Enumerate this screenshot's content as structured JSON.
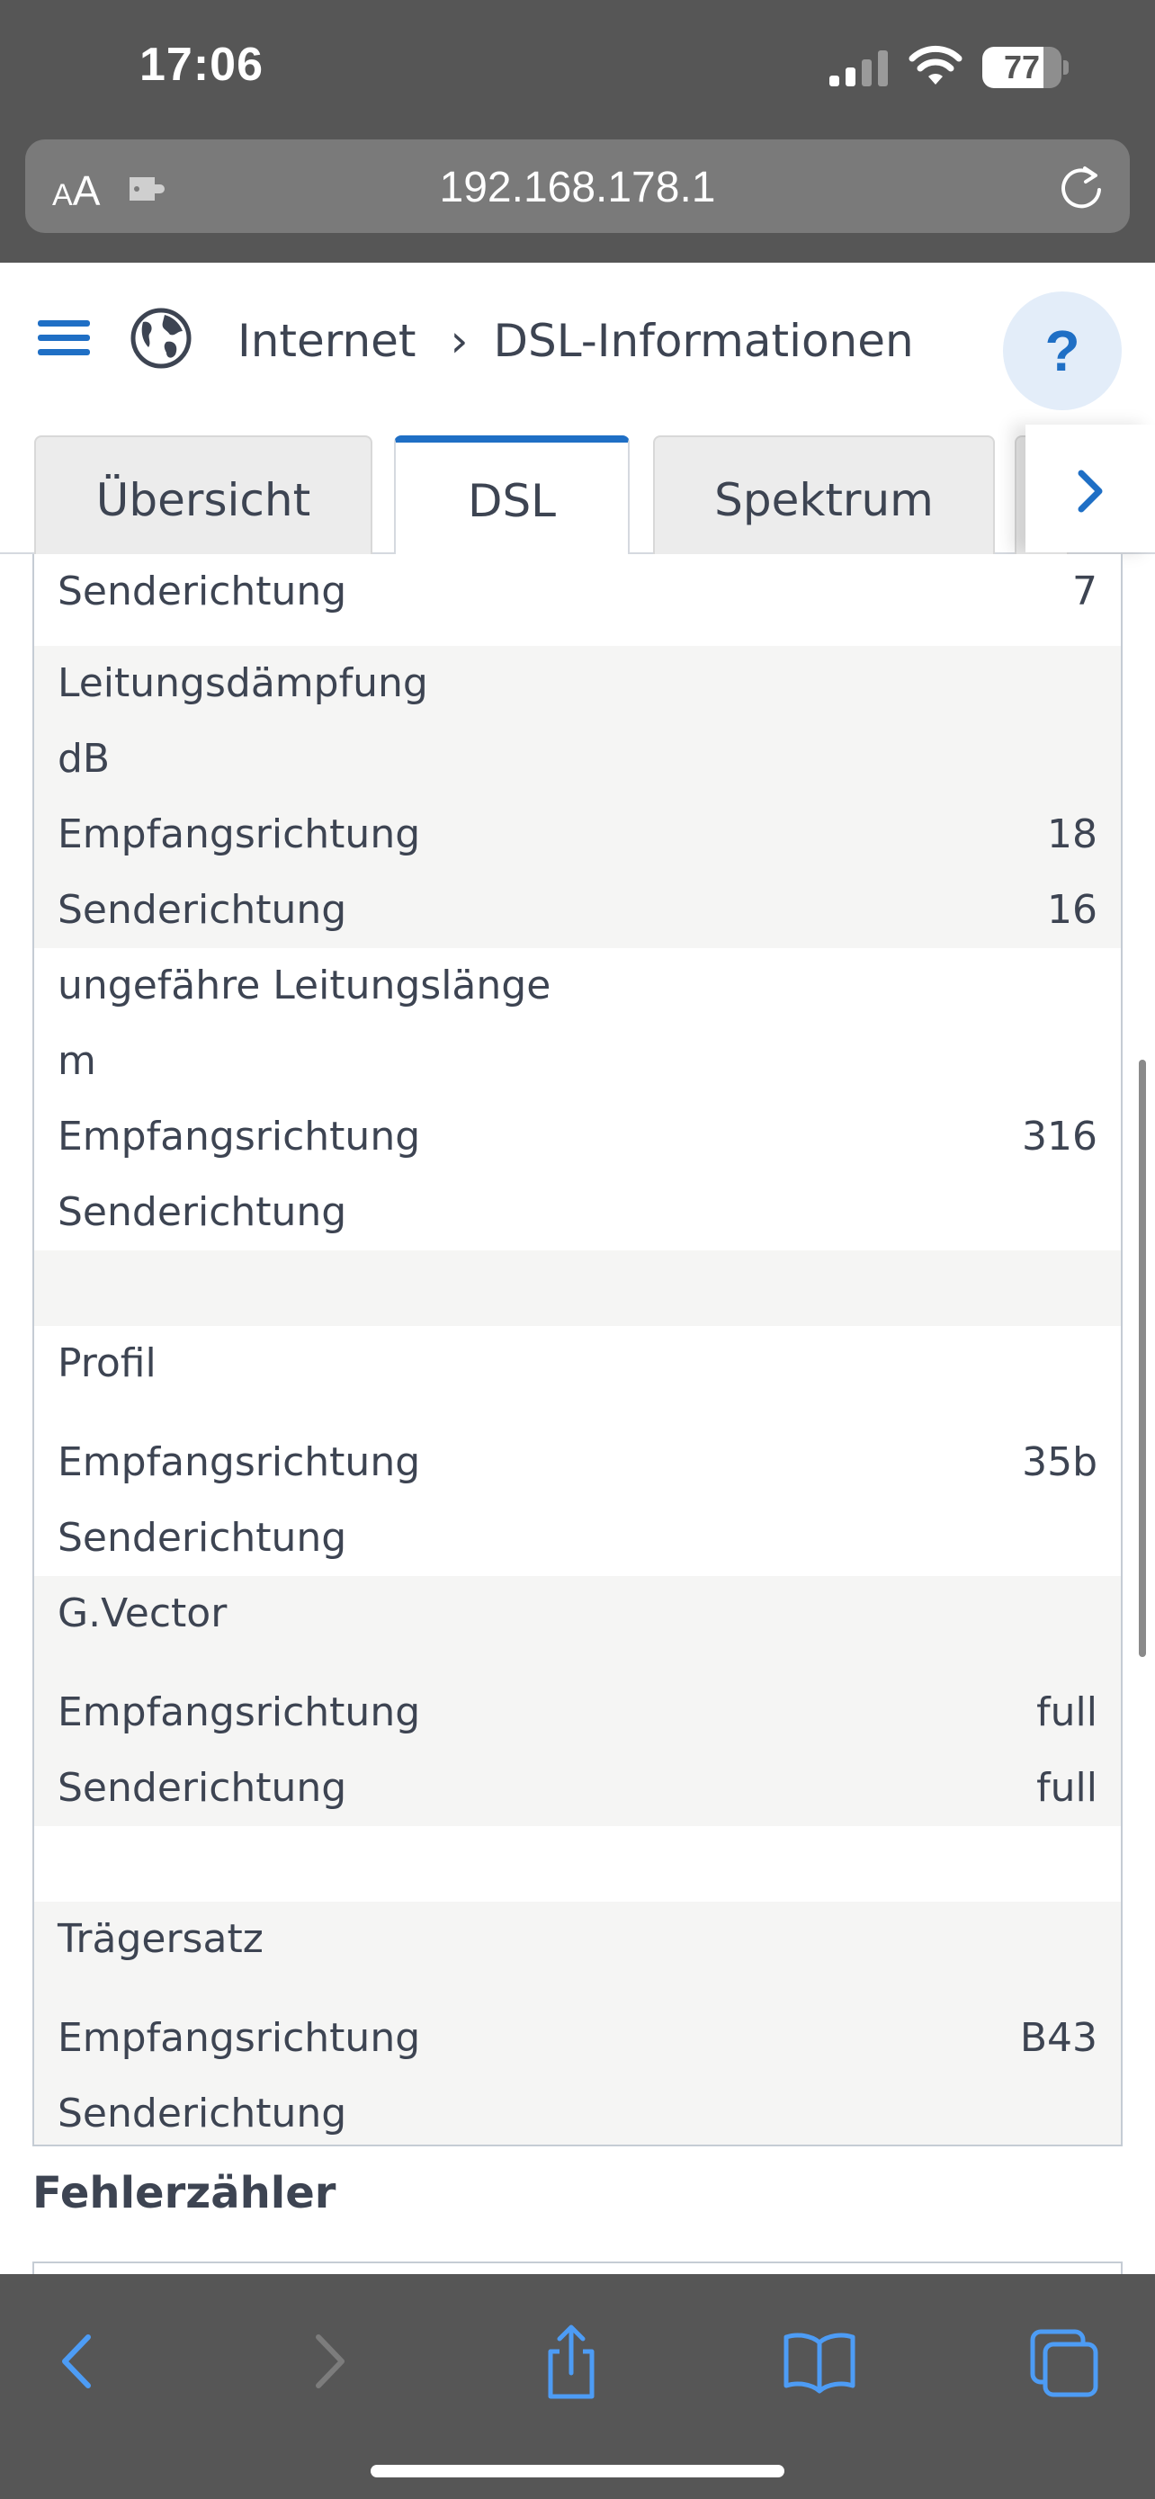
{
  "status_bar": {
    "time": "17:06",
    "battery_level": "77",
    "battery_fraction": 0.77
  },
  "browser": {
    "text_size_small": "A",
    "text_size_big": "A",
    "url": "192.168.178.1"
  },
  "header": {
    "breadcrumb_parent": "Internet",
    "breadcrumb_separator": "›",
    "breadcrumb_current": "DSL-Informationen",
    "help_label": "?"
  },
  "tabs": [
    {
      "label": "Übersicht",
      "active": false
    },
    {
      "label": "DSL",
      "active": true
    },
    {
      "label": "Spektrum",
      "active": false
    }
  ],
  "table": {
    "rows": [
      {
        "label": "Senderichtung",
        "value": "7"
      },
      {
        "label": "Leitungsdämpfung",
        "value": ""
      },
      {
        "label": "dB",
        "value": ""
      },
      {
        "label": "Empfangsrichtung",
        "value": "18"
      },
      {
        "label": "Senderichtung",
        "value": "16"
      },
      {
        "label": "ungefähre Leitungslänge",
        "value": ""
      },
      {
        "label": "m",
        "value": ""
      },
      {
        "label": "Empfangsrichtung",
        "value": "316"
      },
      {
        "label": "Senderichtung",
        "value": ""
      },
      {
        "label": "",
        "value": ""
      },
      {
        "label": "Profil",
        "value": ""
      },
      {
        "label": "Empfangsrichtung",
        "value": "35b"
      },
      {
        "label": "Senderichtung",
        "value": ""
      },
      {
        "label": "G.Vector",
        "value": ""
      },
      {
        "label": "Empfangsrichtung",
        "value": "full"
      },
      {
        "label": "Senderichtung",
        "value": "full"
      },
      {
        "label": "",
        "value": ""
      },
      {
        "label": "Trägersatz",
        "value": ""
      },
      {
        "label": "Empfangsrichtung",
        "value": "B43"
      },
      {
        "label": "Senderichtung",
        "value": ""
      }
    ]
  },
  "sections": {
    "error_counter_title": "Fehlerzähler"
  },
  "colors": {
    "accent": "#1f6fc5",
    "chrome": "#565656",
    "row_gray": "#f5f5f4",
    "text": "#3d4452"
  }
}
